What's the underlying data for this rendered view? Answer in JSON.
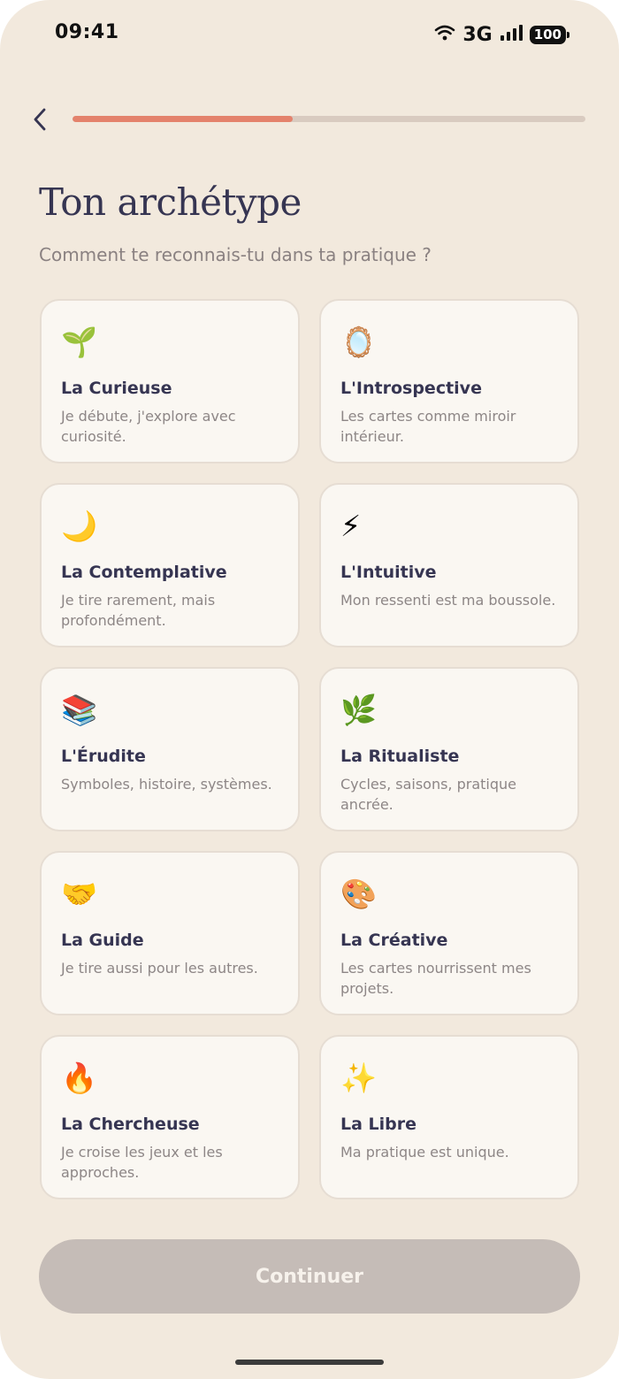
{
  "status_bar": {
    "time": "09:41",
    "network": "3G",
    "battery": "100"
  },
  "progress": {
    "value": 0.43,
    "fill_color": "#e4826c",
    "track_color": "#d9cbc0"
  },
  "title": "Ton archétype",
  "subtitle": "Comment te reconnais-tu dans ta pratique ?",
  "archetypes": [
    {
      "icon": "🌱",
      "icon_name": "seedling-icon",
      "title": "La Curieuse",
      "description": "Je débute, j'explore avec curiosité."
    },
    {
      "icon": "🪞",
      "icon_name": "mirror-icon",
      "title": "L'Introspective",
      "description": "Les cartes comme miroir intérieur."
    },
    {
      "icon": "🌙",
      "icon_name": "crescent-moon-icon",
      "title": "La Contemplative",
      "description": "Je tire rarement, mais profondément."
    },
    {
      "icon": "⚡",
      "icon_name": "lightning-icon",
      "title": "L'Intuitive",
      "description": "Mon ressenti est ma boussole."
    },
    {
      "icon": "📚",
      "icon_name": "books-icon",
      "title": "L'Érudite",
      "description": "Symboles, histoire, systèmes."
    },
    {
      "icon": "🌿",
      "icon_name": "herb-icon",
      "title": "La Ritualiste",
      "description": "Cycles, saisons, pratique ancrée."
    },
    {
      "icon": "🤝",
      "icon_name": "handshake-icon",
      "title": "La Guide",
      "description": "Je tire aussi pour les autres."
    },
    {
      "icon": "🎨",
      "icon_name": "palette-icon",
      "title": "La Créative",
      "description": "Les cartes nourrissent mes projets."
    },
    {
      "icon": "🔥",
      "icon_name": "fire-icon",
      "title": "La Chercheuse",
      "description": "Je croise les jeux et les approches."
    },
    {
      "icon": "✨",
      "icon_name": "sparkles-icon",
      "title": "La Libre",
      "description": "Ma pratique est unique."
    }
  ],
  "continue_label": "Continuer",
  "colors": {
    "background": "#f2e9dd",
    "card": "#faf7f2",
    "title_text": "#363552",
    "button_disabled": "#c5bcb7"
  }
}
